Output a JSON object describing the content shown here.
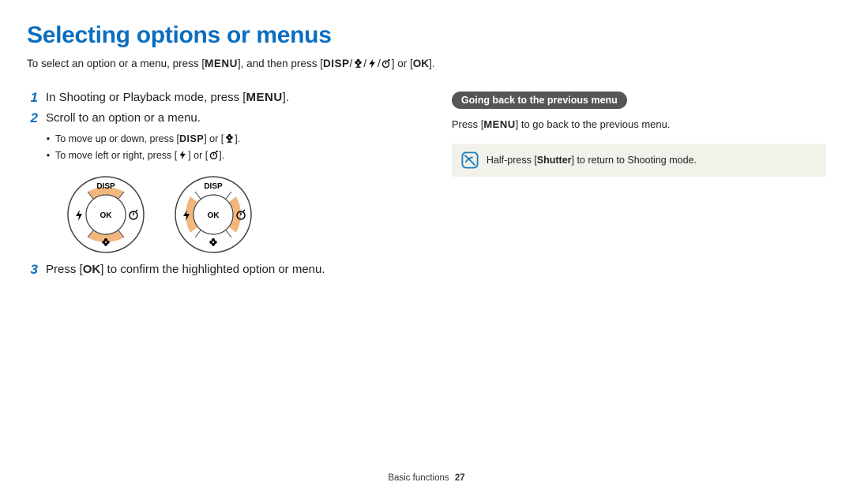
{
  "title": "Selecting options or menus",
  "intro": {
    "pre": "To select an option or a menu, press [",
    "menu": "MENU",
    "mid": "], and then press [",
    "disp": "DISP",
    "or_word": "] or [",
    "ok": "OK",
    "post": "]."
  },
  "steps": {
    "n1": "1",
    "s1a": "In Shooting or Playback mode, press [",
    "s1menu": "MENU",
    "s1b": "].",
    "n2": "2",
    "s2": "Scroll to an option or a menu.",
    "b1a": "To move up or down, press [",
    "b1disp": "DISP",
    "b1mid": "] or [",
    "b1end": "].",
    "b2a": "To move left or right, press [",
    "b2mid": "] or [",
    "b2end": "].",
    "n3": "3",
    "s3a": "Press [",
    "s3ok": "OK",
    "s3b": "] to confirm the highlighted option or menu."
  },
  "dial": {
    "disp": "DISP",
    "ok": "OK"
  },
  "right": {
    "subhdr": "Going back to the previous menu",
    "line_a": "Press [",
    "line_menu": "MENU",
    "line_b": "] to go back to the previous menu."
  },
  "note": {
    "a": "Half-press [",
    "shutter": "Shutter",
    "b": "] to return to Shooting mode."
  },
  "footer": {
    "section": "Basic functions",
    "page": "27"
  }
}
